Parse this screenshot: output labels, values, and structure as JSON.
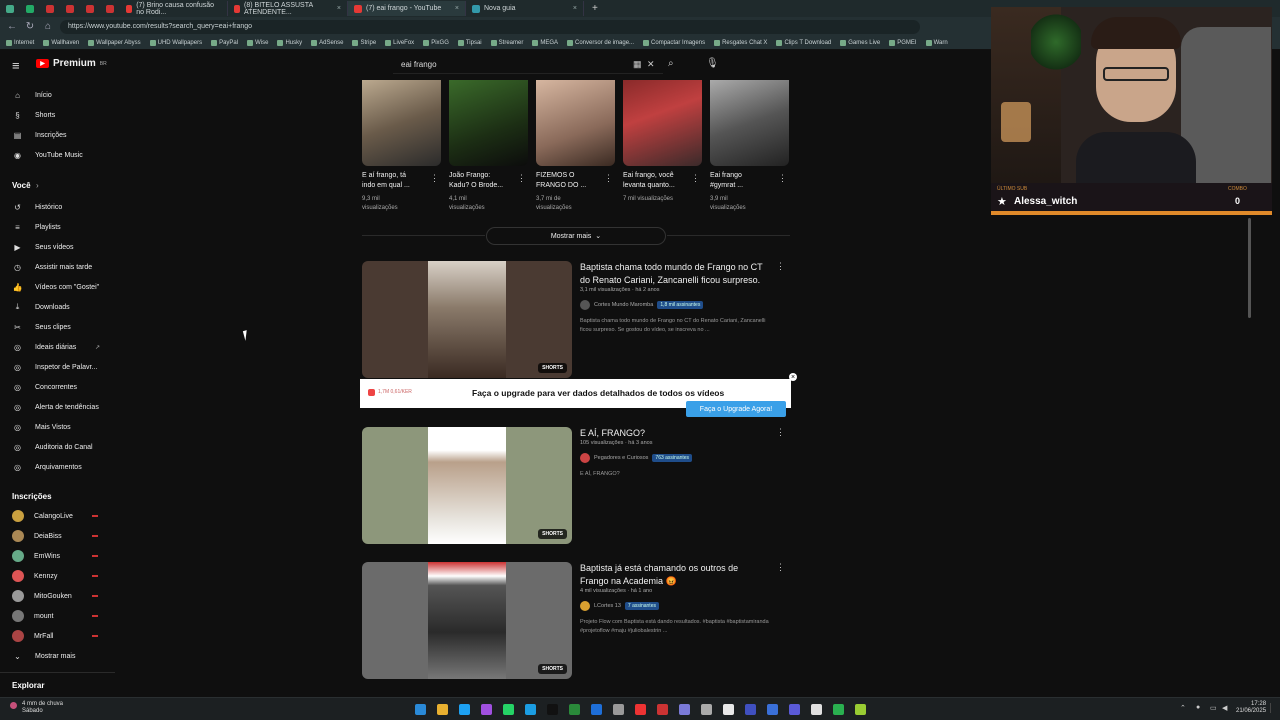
{
  "browser": {
    "tabs": [
      {
        "title": "(7) Brino causa confusão no Rodi..."
      },
      {
        "title": "(8) BITELO ASSUSTA ATENDENTE..."
      },
      {
        "title": "(7) eai frango - YouTube"
      },
      {
        "title": "Nova guia"
      }
    ],
    "new_tab": "+",
    "url": "https://www.youtube.com/results?search_query=eai+frango",
    "bookmarks": [
      "Internet",
      "Wallhaven",
      "Wallpaper Abyss",
      "UHD Wallpapers",
      "PayPal",
      "Wise",
      "Husky",
      "AdSense",
      "Stripe",
      "LiveFox",
      "PixGG",
      "Tipsai",
      "Streamer",
      "MEGA",
      "Conversor de image...",
      "Compactar Imagens",
      "Resgates Chat X",
      "Clips T Download",
      "Games Live",
      "PGMEI",
      "Warn"
    ]
  },
  "header": {
    "logo": "Premium",
    "logo_sup": "BR",
    "search_value": "eai frango"
  },
  "sidebar": {
    "main": [
      {
        "label": "Início",
        "icon": "⌂"
      },
      {
        "label": "Shorts",
        "icon": "§"
      },
      {
        "label": "Inscrições",
        "icon": "▤"
      }
    ],
    "ytmusic": "YouTube Music",
    "voce": "Você",
    "voce_items": [
      {
        "label": "Histórico",
        "icon": "↺"
      },
      {
        "label": "Playlists",
        "icon": "≡"
      },
      {
        "label": "Seus vídeos",
        "icon": "▶"
      },
      {
        "label": "Assistir mais tarde",
        "icon": "◷"
      },
      {
        "label": "Vídeos com \"Gostei\"",
        "icon": "👍"
      },
      {
        "label": "Downloads",
        "icon": "⤓"
      },
      {
        "label": "Seus clipes",
        "icon": "✂"
      }
    ],
    "ext_items": [
      {
        "label": "Ideais diárias"
      },
      {
        "label": "Inspetor de Palavr..."
      },
      {
        "label": "Concorrentes"
      },
      {
        "label": "Alerta de tendências"
      },
      {
        "label": "Mais Vistos"
      },
      {
        "label": "Auditoria do Canal"
      },
      {
        "label": "Arquivamentos"
      }
    ],
    "subs_title": "Inscrições",
    "subs": [
      {
        "name": "CalangoLive"
      },
      {
        "name": "DeiaBiss"
      },
      {
        "name": "EmWins"
      },
      {
        "name": "Kennzy"
      },
      {
        "name": "MitoGouken"
      },
      {
        "name": "mount"
      },
      {
        "name": "MrFall"
      }
    ],
    "show_more": "Mostrar mais",
    "explore": "Explorar"
  },
  "shorts_row": [
    {
      "title1": "E aí frango, tá",
      "title2": "indo em qual ...",
      "meta1": "9,3 mil",
      "meta2": "visualizações"
    },
    {
      "title1": "João Frango:",
      "title2": "Kadu? O Brode...",
      "meta1": "4,1 mil",
      "meta2": "visualizações"
    },
    {
      "title1": "FIZEMOS O",
      "title2": "FRANGO DO ...",
      "meta1": "3,7 mi de",
      "meta2": "visualizações"
    },
    {
      "title1": "Eai frango, você",
      "title2": "levanta quanto...",
      "meta1": "7 mil visualizações",
      "meta2": ""
    },
    {
      "title1": "Eai frango",
      "title2": "#gymrat ...",
      "meta1": "3,9 mil",
      "meta2": "visualizações"
    }
  ],
  "show_more_btn": "Mostrar mais",
  "results": [
    {
      "title1": "Baptista chama todo mundo de Frango no CT",
      "title2": "do Renato Cariani, Zancanelli ficou surpreso.",
      "meta": "3,1 mil visualizações · há 2 anos",
      "channel": "Cortes Mundo Maromba",
      "badge": "1,8 mil assinantes",
      "desc1": "Baptista chama todo mundo de Frango no CT do Renato Cariani, Zancanelli",
      "desc2": "ficou surpreso. Se gostou do vídeo, se inscreva no ...",
      "shorts": "SHORTS"
    },
    {
      "title1": "E AÍ, FRANGO?",
      "title2": "",
      "meta": "105 visualizações · há 3 anos",
      "channel": "Pegadores e Curiosos",
      "badge": "763 assinantes",
      "desc1": "E AÍ, FRANGO?",
      "desc2": "",
      "shorts": "SHORTS"
    },
    {
      "title1": "Baptista já está chamando os outros de",
      "title2": "Frango na Academia 😡",
      "meta": "4 mil visualizações · há 1 ano",
      "channel": "LCortes 13",
      "badge": "7 assinantes",
      "desc1": "Projeto Flow com Baptista está dando resultados. #baptista #baptistamiranda",
      "desc2": "#projetoflow #maju #juliobalestrin ...",
      "shorts": "SHORTS"
    }
  ],
  "upgrade": {
    "stats": "1,7M  0,61/KER",
    "text": "Faça o upgrade para ver dados detalhados de todos os vídeos",
    "button": "Faça o Upgrade Agora!",
    "close": "×"
  },
  "cam": {
    "label_left": "ÚLTIMO SUB",
    "name": "Alessa_witch",
    "label_right": "COMBO",
    "count": "0"
  },
  "taskbar": {
    "weather1": "4 mm de chuva",
    "weather2": "Sábado",
    "time": "17:28",
    "date": "21/06/2025"
  }
}
